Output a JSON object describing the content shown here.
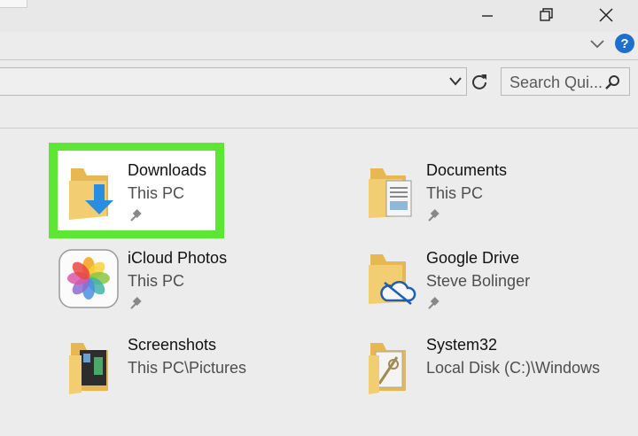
{
  "window": {
    "minimize_icon": "minimize-icon",
    "maximize_icon": "restore-icon",
    "close_icon": "close-icon",
    "help_label": "?"
  },
  "toolbar": {
    "search_placeholder": "Search Qui..."
  },
  "quick_access": [
    {
      "name": "Downloads",
      "location": "This PC",
      "icon": "downloads-folder-icon",
      "pinned": true,
      "highlighted": true
    },
    {
      "name": "Documents",
      "location": "This PC",
      "icon": "documents-folder-icon",
      "pinned": true
    },
    {
      "name": "iCloud Photos",
      "location": "This PC",
      "icon": "icloud-photos-icon",
      "pinned": true
    },
    {
      "name": "Google Drive",
      "location": "Steve Bolinger",
      "icon": "google-drive-folder-icon",
      "pinned": true
    },
    {
      "name": "Screenshots",
      "location": "This PC\\Pictures",
      "icon": "screenshots-folder-icon",
      "pinned": false
    },
    {
      "name": "System32",
      "location": "Local Disk (C:)\\Windows",
      "icon": "system32-folder-icon",
      "pinned": false
    }
  ],
  "colors": {
    "highlight_border": "#5ee635",
    "folder_yellow": "#f2cd72",
    "download_arrow": "#2a8ee0",
    "help_blue": "#1f6fcf"
  }
}
